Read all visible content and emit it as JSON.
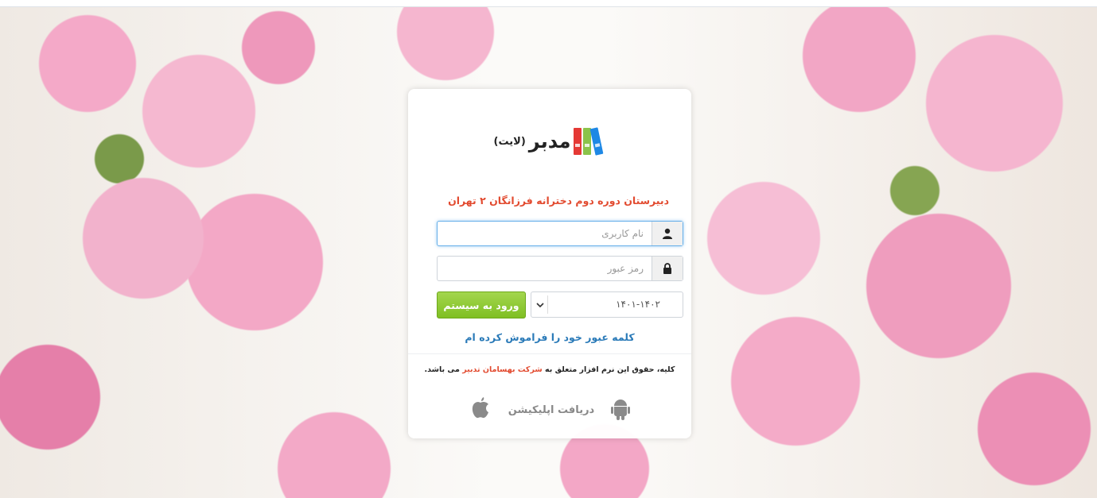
{
  "app": {
    "logo_text": "مدبر",
    "logo_sub": "(لایت)"
  },
  "login": {
    "school_name": "دبیرستان دوره دوم دخترانه فرزانگان ۲ تهران",
    "username_placeholder": "نام کاربری",
    "username_icon": "user-icon",
    "password_placeholder": "رمز عبور",
    "password_icon": "lock-icon",
    "year_selected": "۱۴۰۱-۱۴۰۲",
    "login_button": "ورود به سیستم",
    "forgot_password": "کلمه عبور خود را فراموش کرده ام"
  },
  "footer": {
    "copyright_prefix": "کلیه، حقوق این نرم افزار متعلق به",
    "copyright_brand": "شرکت بهسامان تدبیر",
    "copyright_suffix": "می باشد.",
    "download_app": "دریافت اپلیکیشن"
  },
  "colors": {
    "accent_red": "#e24a2f",
    "link_blue": "#2a7ab8",
    "button_green": "#8bc34a"
  }
}
